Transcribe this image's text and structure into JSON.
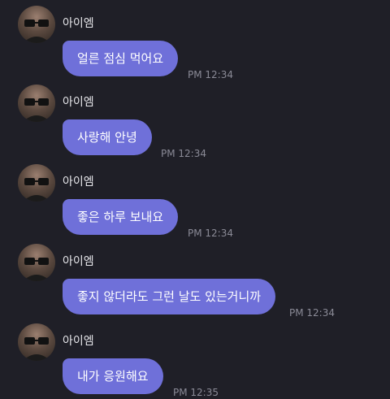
{
  "messages": [
    {
      "sender": "아이엠",
      "text": "얼른 점심 먹어요",
      "time": "PM 12:34"
    },
    {
      "sender": "아이엠",
      "text": "사랑해 안녕",
      "time": "PM 12:34"
    },
    {
      "sender": "아이엠",
      "text": "좋은 하루 보내요",
      "time": "PM 12:34"
    },
    {
      "sender": "아이엠",
      "text": "좋지 않더라도 그런 날도 있는거니까",
      "time": "PM 12:34"
    },
    {
      "sender": "아이엠",
      "text": "내가 응원해요",
      "time": "PM 12:35"
    }
  ]
}
